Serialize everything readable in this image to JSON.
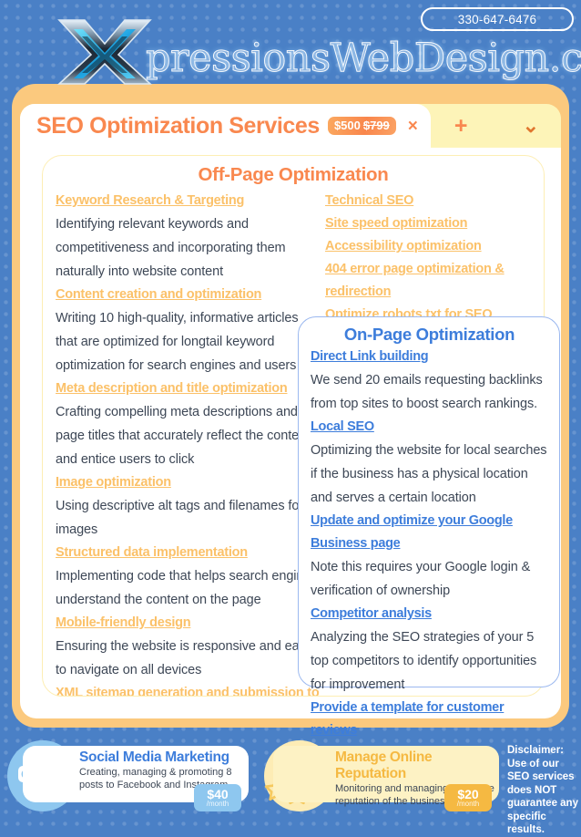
{
  "header": {
    "phone": "330-647-6476",
    "brand_text": "pressionsWebDesign.com",
    "logo_letter": "X"
  },
  "tabstrip": {
    "title": "SEO Optimization Services",
    "price_new": "$500",
    "price_old": "$799",
    "close_glyph": "×",
    "add_glyph": "+",
    "chevron_glyph": "⌄"
  },
  "offpage": {
    "title": "Off-Page Optimization",
    "left_items": [
      {
        "type": "link",
        "text": "Keyword Research & Targeting"
      },
      {
        "type": "desc",
        "text": "Identifying relevant keywords and competitiveness and incorporating them naturally into website content"
      },
      {
        "type": "link",
        "text": "Content creation and optimization"
      },
      {
        "type": "desc",
        "text": "Writing 10 high-quality, informative articles that are optimized for longtail keyword optimization for search engines and users"
      },
      {
        "type": "link",
        "text": "Meta description and title optimization"
      },
      {
        "type": "desc",
        "text": "Crafting compelling meta descriptions and page titles that accurately reflect the content and entice users to click"
      },
      {
        "type": "link",
        "text": "Image optimization"
      },
      {
        "type": "desc",
        "text": "Using descriptive alt tags and filenames for images"
      },
      {
        "type": "link",
        "text": "Structured data implementation"
      },
      {
        "type": "desc",
        "text": "Implementing code that helps search engines understand the content on the page"
      },
      {
        "type": "link",
        "text": "Mobile-friendly design"
      },
      {
        "type": "desc",
        "text": "Ensuring the website is responsive and easy to navigate on all devices"
      },
      {
        "type": "link",
        "text": "XML sitemap generation and  submission to Google"
      }
    ],
    "right_items": [
      {
        "type": "link",
        "text": "Technical SEO"
      },
      {
        "type": "link",
        "text": "Site speed optimization"
      },
      {
        "type": "link",
        "text": "Accessibility optimization"
      },
      {
        "type": "link",
        "text": "404 error page optimization & redirection"
      },
      {
        "type": "link",
        "text": "Optimize robots.txt for SEO"
      }
    ]
  },
  "onpage": {
    "title": "On-Page Optimization",
    "items": [
      {
        "type": "link",
        "text": "Direct Link building"
      },
      {
        "type": "desc",
        "text": "We send 20 emails requesting backlinks from top sites to boost search rankings."
      },
      {
        "type": "link",
        "text": "Local SEO"
      },
      {
        "type": "desc",
        "text": "Optimizing the website for local searches if the business has a physical location and serves a certain location"
      },
      {
        "type": "link",
        "text": "Update and optimize your Google Business page"
      },
      {
        "type": "desc",
        "text": "Note this requires your Google login & verification of ownership"
      },
      {
        "type": "link",
        "text": "Competitor analysis"
      },
      {
        "type": "desc",
        "text": "Analyzing the SEO strategies of your 5 top competitors to identify opportunities for improvement"
      },
      {
        "type": "link",
        "text": "Provide a template for customer reviews"
      }
    ]
  },
  "bottom": {
    "services": [
      {
        "title": "Social Media Marketing",
        "desc": "Creating, managing & promoting 8 posts to Facebook and Instagram",
        "price": "$40",
        "period": "/month",
        "icon": "social-media-icon"
      },
      {
        "title": "Manage Online Reputation",
        "desc": "Monitoring and managing the online reputation of the business",
        "price": "$20",
        "period": "/month",
        "icon": "checkmark-stars-icon"
      }
    ],
    "disclaimer": "Disclaimer: Use of our SEO services does NOT guarantee any specific results."
  },
  "colors": {
    "background_blue": "#4a80c6",
    "card_orange": "#fbc97e",
    "tab_yellow": "#fdf4b8",
    "accent_orange": "#f9884f",
    "link_orange": "#fbc169",
    "link_blue": "#3d7ddb",
    "text_dark": "#3d4756"
  }
}
